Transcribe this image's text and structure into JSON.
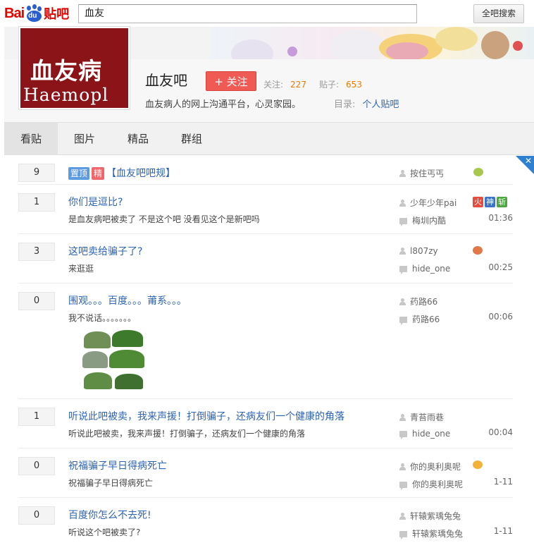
{
  "topbar": {
    "logo_bai": "Bai",
    "logo_du": "du",
    "logo_tieba": "贴吧",
    "search_value": "血友",
    "search_button": "全吧搜索"
  },
  "forum": {
    "image_text": "血友病",
    "image_latin": "Haemopl",
    "name": "血友吧",
    "follow_label": "+ 关注",
    "follow_count_label": "关注:",
    "follow_count": "227",
    "posts_label": "贴子:",
    "posts_count": "653",
    "slogan": "血友病人的网上沟通平台，心灵家园。",
    "dir_label": "目录:",
    "dir_value": "个人贴吧"
  },
  "tabs": [
    {
      "label": "看贴",
      "active": true
    },
    {
      "label": "图片",
      "active": false
    },
    {
      "label": "精品",
      "active": false
    },
    {
      "label": "群组",
      "active": false
    }
  ],
  "threads": [
    {
      "replies": "9",
      "tags": [
        "置顶",
        "精"
      ],
      "title": "【血友吧吧规】",
      "excerpt": "",
      "author": "按住丐丐",
      "last_reply": "",
      "time": ""
    },
    {
      "replies": "1",
      "title": "你们是逗比?",
      "excerpt": "是血友病吧被卖了 不是这个吧 没看见这个是新吧吗",
      "author": "少年少年pai",
      "badges": [
        "火",
        "神",
        "斩"
      ],
      "last_reply": "梅圳内酷",
      "time": "01:36"
    },
    {
      "replies": "3",
      "title": "这吧卖给骗子了?",
      "excerpt": "来逛逛",
      "author": "l807zy",
      "last_reply": "hide_one",
      "time": "00:25"
    },
    {
      "replies": "0",
      "title": "围观。。。百度。。。莆系。。。",
      "excerpt": "我不说话。。。。。。。",
      "author": "药路66",
      "last_reply": "药路66",
      "time": "00:06"
    },
    {
      "replies": "1",
      "title": "听说此吧被卖，我来声援！打倒骗子，还病友们一个健康的角落",
      "excerpt": "听说此吧被卖，我来声援！打倒骗子，还病友们一个健康的角落",
      "author": "青苔雨巷",
      "last_reply": "hide_one",
      "time": "00:04"
    },
    {
      "replies": "0",
      "title": "祝福骗子早日得病死亡",
      "excerpt": "祝福骗子早日得病死亡",
      "author": "你的奥利奥呢",
      "last_reply": "你的奥利奥呢",
      "time": "1-11"
    },
    {
      "replies": "0",
      "title": "百度你怎么不去死!",
      "excerpt": "听说这个吧被卖了?",
      "author": "轩辕紫瑀兔兔",
      "last_reply": "轩辕紫瑀兔兔",
      "time": "1-11"
    }
  ],
  "colors": {
    "link": "#2d64b3",
    "follow_button": "#f05a55",
    "count": "#f07a00",
    "top_tag": "#5d9be0",
    "good_tag": "#f0666a"
  }
}
